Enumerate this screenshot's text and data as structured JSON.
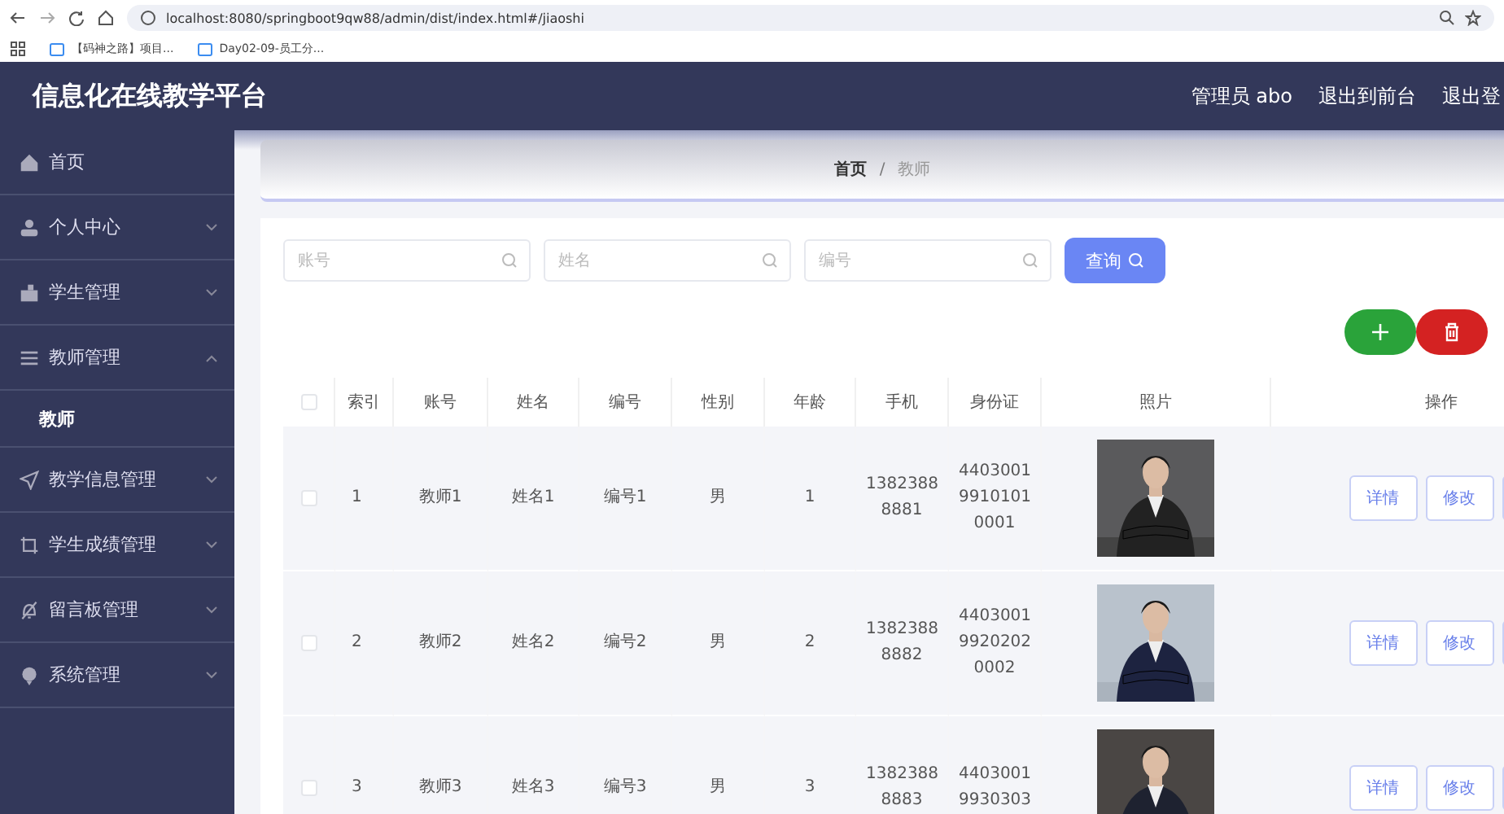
{
  "browser": {
    "url": "localhost:8080/springboot9qw88/admin/dist/index.html#/jiaoshi",
    "bookmarks": [
      "【码神之路】项目...",
      "Day02-09-员工分..."
    ]
  },
  "header": {
    "title": "信息化在线教学平台",
    "links": [
      "管理员 abo",
      "退出到前台",
      "退出登"
    ]
  },
  "sidebar": {
    "items": [
      {
        "label": "首页"
      },
      {
        "label": "个人中心",
        "expanded": false
      },
      {
        "label": "学生管理",
        "expanded": false
      },
      {
        "label": "教师管理",
        "expanded": true,
        "children": [
          {
            "label": "教师",
            "selected": true
          }
        ]
      },
      {
        "label": "教学信息管理",
        "expanded": false
      },
      {
        "label": "学生成绩管理",
        "expanded": false
      },
      {
        "label": "留言板管理",
        "expanded": false
      },
      {
        "label": "系统管理",
        "expanded": false
      }
    ]
  },
  "breadcrumb": {
    "items": [
      "首页",
      "教师"
    ],
    "separator": "/"
  },
  "search": {
    "fields": [
      {
        "placeholder": "账号"
      },
      {
        "placeholder": "姓名"
      },
      {
        "placeholder": "编号"
      }
    ],
    "button": "查询"
  },
  "table": {
    "header_checked": false,
    "columns": [
      "索引",
      "账号",
      "姓名",
      "编号",
      "性别",
      "年龄",
      "手机",
      "身份证",
      "照片",
      "操作"
    ],
    "rows": [
      {
        "checked": false,
        "cells": [
          "1",
          "教师1",
          "姓名1",
          "编号1",
          "男",
          "1",
          "1382388 8881",
          "4403001 9910101 0001"
        ],
        "photo": {
          "kind": "picture"
        },
        "actions": [
          "详情",
          "修改"
        ]
      },
      {
        "checked": false,
        "cells": [
          "2",
          "教师2",
          "姓名2",
          "编号2",
          "男",
          "2",
          "1382388 8882",
          "4403001 9920202 0002"
        ],
        "photo": {
          "kind": "picture"
        },
        "actions": [
          "详情",
          "修改"
        ]
      },
      {
        "checked": false,
        "cells": [
          "3",
          "教师3",
          "姓名3",
          "编号3",
          "男",
          "3",
          "1382388 8883",
          "4403001 9930303"
        ],
        "photo": {
          "kind": "picture"
        },
        "actions": [
          "详情",
          "修改"
        ]
      }
    ]
  }
}
